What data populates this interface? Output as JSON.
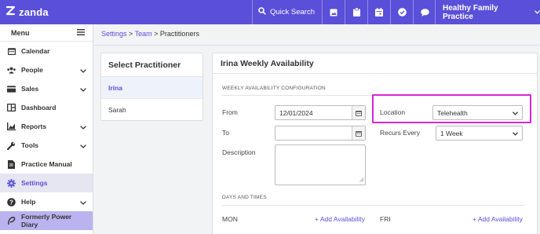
{
  "topbar": {
    "brand": "zanda",
    "quick_search": "Quick Search",
    "practice_name": "Healthy Family Practice",
    "icons": [
      "image-icon",
      "clipboard-icon",
      "calendar-icon",
      "check-circle-icon",
      "chat-icon"
    ]
  },
  "sidebar": {
    "menu_label": "Menu",
    "items": [
      {
        "label": "Calendar",
        "icon": "calendar-icon"
      },
      {
        "label": "People",
        "icon": "people-icon",
        "expandable": true
      },
      {
        "label": "Sales",
        "icon": "card-icon",
        "expandable": true
      },
      {
        "label": "Dashboard",
        "icon": "dashboard-icon"
      },
      {
        "label": "Reports",
        "icon": "chart-icon",
        "expandable": true
      },
      {
        "label": "Tools",
        "icon": "wrench-icon",
        "expandable": true
      },
      {
        "label": "Practice Manual",
        "icon": "document-icon"
      },
      {
        "label": "Settings",
        "icon": "gear-icon",
        "active": true
      },
      {
        "label": "Help",
        "icon": "help-icon",
        "expandable": true
      },
      {
        "label": "Formerly Power Diary",
        "icon": "power-diary-icon"
      }
    ]
  },
  "breadcrumb": {
    "settings": "Settings",
    "sep": " > ",
    "team": "Team",
    "current": "Practitioners"
  },
  "practitioners": {
    "title": "Select Practitioner",
    "items": [
      {
        "name": "Irina",
        "selected": true
      },
      {
        "name": "Sarah",
        "selected": false
      }
    ]
  },
  "availability": {
    "title": "Irina Weekly Availability",
    "config_heading": "WEEKLY AVAILABILITY CONFIGURATION",
    "from_label": "From",
    "from_value": "12/01/2024",
    "to_label": "To",
    "to_value": "",
    "description_label": "Description",
    "location_label": "Location",
    "location_value": "Telehealth",
    "recurs_label": "Recurs Every",
    "recurs_value": "1 Week",
    "days_heading": "DAYS AND TIMES",
    "days": [
      {
        "day": "MON",
        "add": "+ Add Availability"
      },
      {
        "day": "FRI",
        "add": "+ Add Availability"
      }
    ]
  },
  "colors": {
    "brand": "#5a4fd9",
    "highlight": "#d826d8",
    "active_bg": "#e6e5f2",
    "power_bg": "#b9b4ef"
  }
}
